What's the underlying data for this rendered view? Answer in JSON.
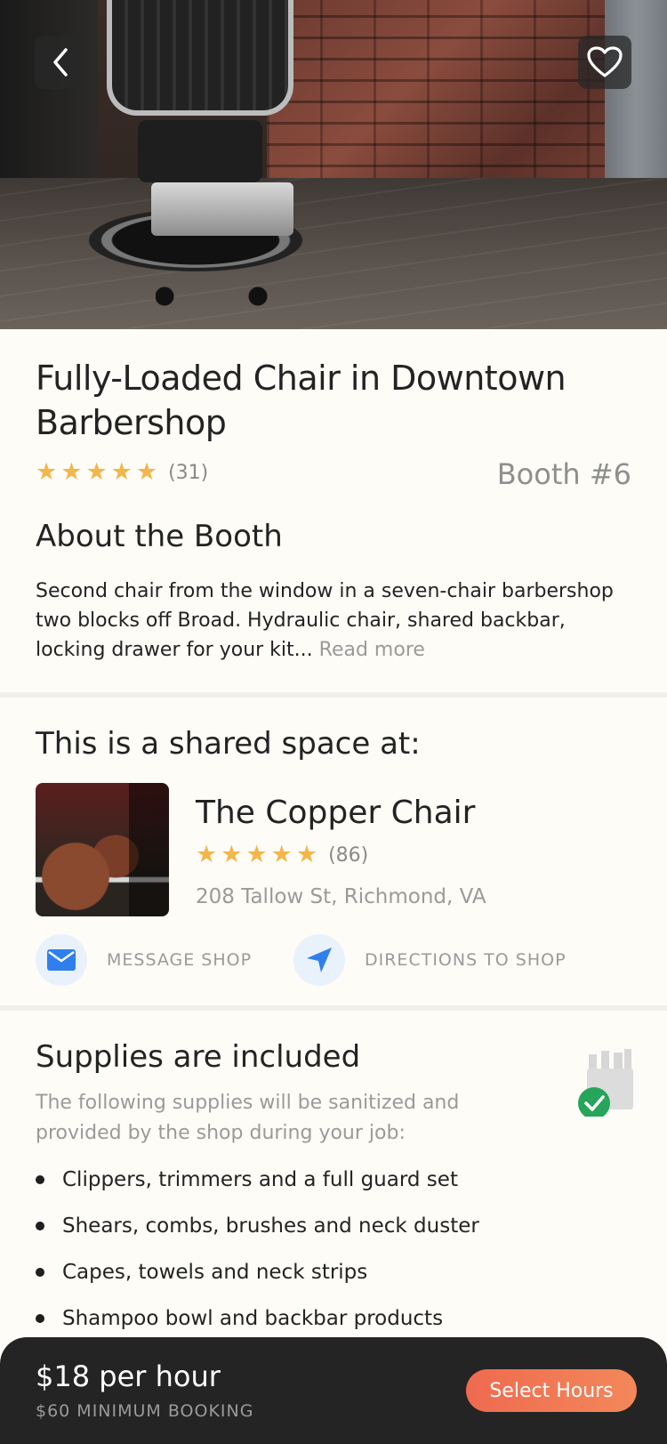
{
  "listing": {
    "title": "Fully-Loaded Chair in Downtown Barbershop",
    "rating_count": "(31)",
    "booth": "Booth #6"
  },
  "about": {
    "heading": "About the Booth",
    "text": "Second chair from the window in a seven-chair barbershop two blocks off Broad. Hydraulic chair, shared backbar, locking drawer for your kit...",
    "read_more": "Read more"
  },
  "shop": {
    "heading": "This is a shared space at:",
    "name": "The Copper Chair",
    "rating_count": "(86)",
    "address": "208 Tallow St, Richmond, VA",
    "message_label": "MESSAGE SHOP",
    "directions_label": "DIRECTIONS TO SHOP"
  },
  "supplies": {
    "heading": "Supplies are included",
    "subtitle": "The following supplies will be sanitized and provided by the shop during your job:",
    "items": [
      "Clippers, trimmers and a full guard set",
      "Shears, combs, brushes and neck duster",
      "Capes, towels and neck strips",
      "Shampoo bowl and backbar products"
    ]
  },
  "footer": {
    "price": "$18 per hour",
    "minimum": "$60 MINIMUM BOOKING",
    "cta_label": "Select Hours"
  },
  "icons": {
    "back": "chevron-left-icon",
    "favorite": "heart-icon",
    "message": "mail-icon",
    "directions": "navigation-arrow-icon",
    "supplies": "supplies-check-icon"
  },
  "colors": {
    "star": "#f2b64a",
    "accent_blue": "#2f80ed",
    "check_green": "#27a55a",
    "cta_start": "#ef6a4f",
    "cta_end": "#f2885a",
    "footer_bg": "#242424"
  }
}
